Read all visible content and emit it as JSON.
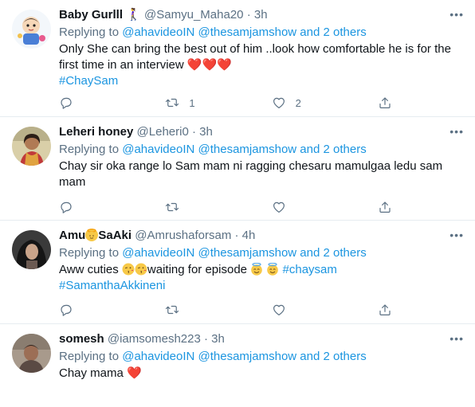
{
  "tweets": [
    {
      "name": "Baby Gurlll 🚶‍♀️",
      "handle": "@Samyu_Maha20",
      "time": "3h",
      "replying_prefix": "Replying to ",
      "mention1": "@ahavideoIN",
      "mention2": "@thesamjamshow",
      "and_others": "and 2 others",
      "text": "Only She can bring the best out of him ..look how comfortable he is for the first time in an interview",
      "hashtag": "#ChaySam",
      "retweets": "1",
      "likes": "2"
    },
    {
      "name": "Leheri honey",
      "handle": "@Leheri0",
      "time": "3h",
      "replying_prefix": "Replying to ",
      "mention1": "@ahavideoIN",
      "mention2": "@thesamjamshow",
      "and_others": "and 2 others",
      "text": "Chay sir oka range lo Sam mam ni ragging chesaru mamulgaa ledu sam mam",
      "retweets": "",
      "likes": ""
    },
    {
      "name_part1": "Amu",
      "name_part2": "SaAki",
      "handle": "@Amrushaforsam",
      "time": "4h",
      "replying_prefix": "Replying to ",
      "mention1": "@ahavideoIN",
      "mention2": "@thesamjamshow",
      "and_others": "and 2 others",
      "text_part1": "Aww cuties ",
      "text_part2": "waiting for episode ",
      "hashtag1": "#chaysam",
      "hashtag2": "#SamanthaAkkineni",
      "retweets": "",
      "likes": ""
    },
    {
      "name": "somesh",
      "handle": "@iamsomesh223",
      "time": "3h",
      "replying_prefix": "Replying to ",
      "mention1": "@ahavideoIN",
      "mention2": "@thesamjamshow",
      "and_others": "and 2 others",
      "text": "Chay mama"
    }
  ],
  "separator": "·",
  "more_glyph": "•••",
  "heart_glyph": "❤️",
  "colors": {
    "link": "#1b95e0",
    "secondary_text": "#5b7083",
    "heart": "#e0245e",
    "divider": "#e6ecf0"
  },
  "icons": [
    "reply-icon",
    "retweet-icon",
    "like-icon",
    "share-icon",
    "more-icon"
  ]
}
